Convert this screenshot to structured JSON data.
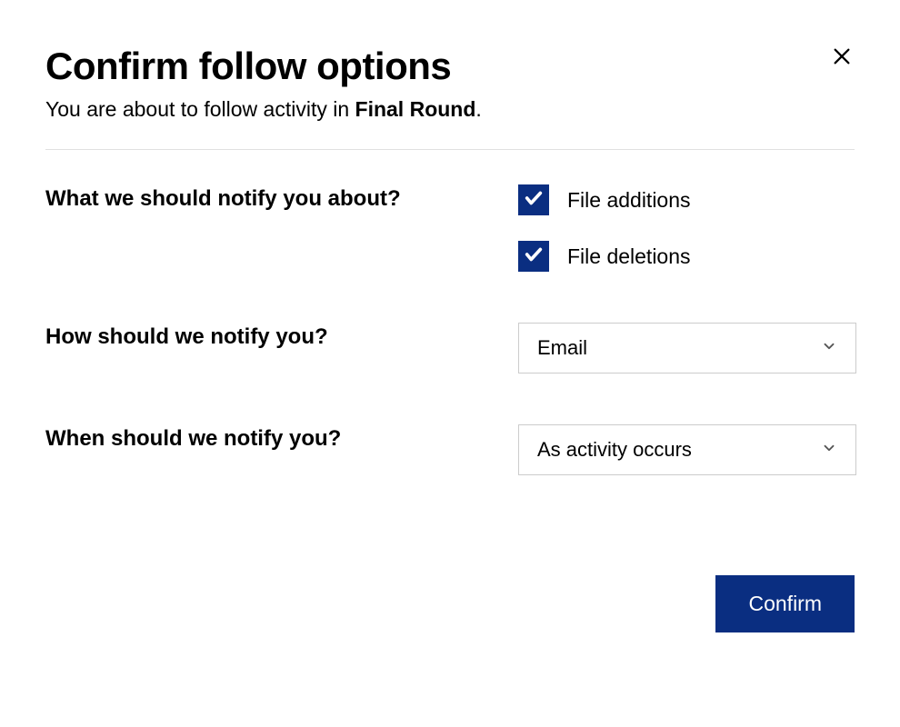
{
  "colors": {
    "primary": "#0a2e81"
  },
  "header": {
    "title": "Confirm follow options",
    "subtitle_prefix": "You are about to follow activity in ",
    "subtitle_bold": "Final Round",
    "subtitle_suffix": "."
  },
  "sections": {
    "notify_about": {
      "label": "What we should notify you about?",
      "options": [
        {
          "label": "File additions",
          "checked": true
        },
        {
          "label": "File deletions",
          "checked": true
        }
      ]
    },
    "notify_how": {
      "label": "How should we notify you?",
      "selected": "Email"
    },
    "notify_when": {
      "label": "When should we notify you?",
      "selected": "As activity occurs"
    }
  },
  "footer": {
    "confirm_label": "Confirm"
  }
}
